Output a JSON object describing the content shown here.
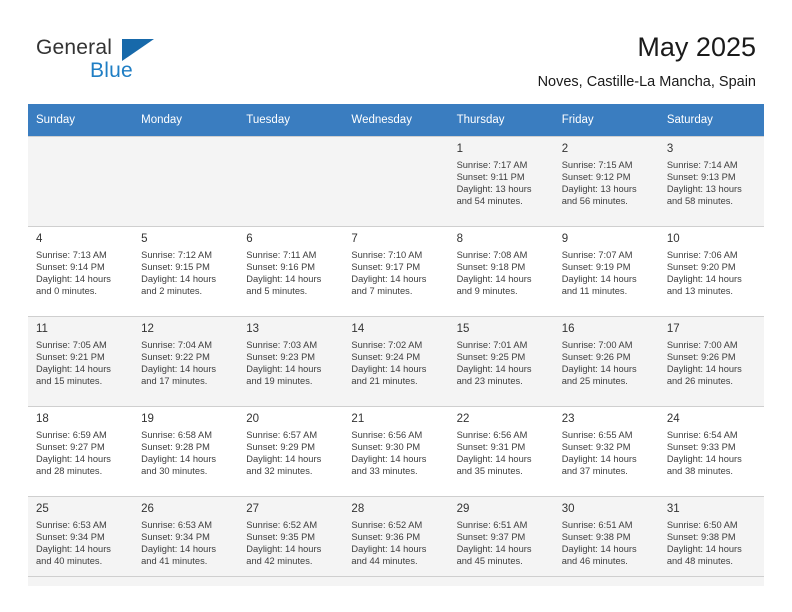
{
  "brand": {
    "name_part1": "General",
    "name_part2": "Blue",
    "flag_icon": "triangle-flag-icon",
    "accent_color": "#1f7ec4"
  },
  "header": {
    "title": "May 2025",
    "subtitle": "Noves, Castille-La Mancha, Spain"
  },
  "calendar": {
    "header_background": "#3a7dc0",
    "weekdays": [
      "Sunday",
      "Monday",
      "Tuesday",
      "Wednesday",
      "Thursday",
      "Friday",
      "Saturday"
    ],
    "weeks": [
      [
        {
          "day": "",
          "sunrise": "",
          "sunset": "",
          "daylight_line1": "",
          "daylight_line2": ""
        },
        {
          "day": "",
          "sunrise": "",
          "sunset": "",
          "daylight_line1": "",
          "daylight_line2": ""
        },
        {
          "day": "",
          "sunrise": "",
          "sunset": "",
          "daylight_line1": "",
          "daylight_line2": ""
        },
        {
          "day": "",
          "sunrise": "",
          "sunset": "",
          "daylight_line1": "",
          "daylight_line2": ""
        },
        {
          "day": "1",
          "sunrise": "Sunrise: 7:17 AM",
          "sunset": "Sunset: 9:11 PM",
          "daylight_line1": "Daylight: 13 hours",
          "daylight_line2": "and 54 minutes."
        },
        {
          "day": "2",
          "sunrise": "Sunrise: 7:15 AM",
          "sunset": "Sunset: 9:12 PM",
          "daylight_line1": "Daylight: 13 hours",
          "daylight_line2": "and 56 minutes."
        },
        {
          "day": "3",
          "sunrise": "Sunrise: 7:14 AM",
          "sunset": "Sunset: 9:13 PM",
          "daylight_line1": "Daylight: 13 hours",
          "daylight_line2": "and 58 minutes."
        }
      ],
      [
        {
          "day": "4",
          "sunrise": "Sunrise: 7:13 AM",
          "sunset": "Sunset: 9:14 PM",
          "daylight_line1": "Daylight: 14 hours",
          "daylight_line2": "and 0 minutes."
        },
        {
          "day": "5",
          "sunrise": "Sunrise: 7:12 AM",
          "sunset": "Sunset: 9:15 PM",
          "daylight_line1": "Daylight: 14 hours",
          "daylight_line2": "and 2 minutes."
        },
        {
          "day": "6",
          "sunrise": "Sunrise: 7:11 AM",
          "sunset": "Sunset: 9:16 PM",
          "daylight_line1": "Daylight: 14 hours",
          "daylight_line2": "and 5 minutes."
        },
        {
          "day": "7",
          "sunrise": "Sunrise: 7:10 AM",
          "sunset": "Sunset: 9:17 PM",
          "daylight_line1": "Daylight: 14 hours",
          "daylight_line2": "and 7 minutes."
        },
        {
          "day": "8",
          "sunrise": "Sunrise: 7:08 AM",
          "sunset": "Sunset: 9:18 PM",
          "daylight_line1": "Daylight: 14 hours",
          "daylight_line2": "and 9 minutes."
        },
        {
          "day": "9",
          "sunrise": "Sunrise: 7:07 AM",
          "sunset": "Sunset: 9:19 PM",
          "daylight_line1": "Daylight: 14 hours",
          "daylight_line2": "and 11 minutes."
        },
        {
          "day": "10",
          "sunrise": "Sunrise: 7:06 AM",
          "sunset": "Sunset: 9:20 PM",
          "daylight_line1": "Daylight: 14 hours",
          "daylight_line2": "and 13 minutes."
        }
      ],
      [
        {
          "day": "11",
          "sunrise": "Sunrise: 7:05 AM",
          "sunset": "Sunset: 9:21 PM",
          "daylight_line1": "Daylight: 14 hours",
          "daylight_line2": "and 15 minutes."
        },
        {
          "day": "12",
          "sunrise": "Sunrise: 7:04 AM",
          "sunset": "Sunset: 9:22 PM",
          "daylight_line1": "Daylight: 14 hours",
          "daylight_line2": "and 17 minutes."
        },
        {
          "day": "13",
          "sunrise": "Sunrise: 7:03 AM",
          "sunset": "Sunset: 9:23 PM",
          "daylight_line1": "Daylight: 14 hours",
          "daylight_line2": "and 19 minutes."
        },
        {
          "day": "14",
          "sunrise": "Sunrise: 7:02 AM",
          "sunset": "Sunset: 9:24 PM",
          "daylight_line1": "Daylight: 14 hours",
          "daylight_line2": "and 21 minutes."
        },
        {
          "day": "15",
          "sunrise": "Sunrise: 7:01 AM",
          "sunset": "Sunset: 9:25 PM",
          "daylight_line1": "Daylight: 14 hours",
          "daylight_line2": "and 23 minutes."
        },
        {
          "day": "16",
          "sunrise": "Sunrise: 7:00 AM",
          "sunset": "Sunset: 9:26 PM",
          "daylight_line1": "Daylight: 14 hours",
          "daylight_line2": "and 25 minutes."
        },
        {
          "day": "17",
          "sunrise": "Sunrise: 7:00 AM",
          "sunset": "Sunset: 9:26 PM",
          "daylight_line1": "Daylight: 14 hours",
          "daylight_line2": "and 26 minutes."
        }
      ],
      [
        {
          "day": "18",
          "sunrise": "Sunrise: 6:59 AM",
          "sunset": "Sunset: 9:27 PM",
          "daylight_line1": "Daylight: 14 hours",
          "daylight_line2": "and 28 minutes."
        },
        {
          "day": "19",
          "sunrise": "Sunrise: 6:58 AM",
          "sunset": "Sunset: 9:28 PM",
          "daylight_line1": "Daylight: 14 hours",
          "daylight_line2": "and 30 minutes."
        },
        {
          "day": "20",
          "sunrise": "Sunrise: 6:57 AM",
          "sunset": "Sunset: 9:29 PM",
          "daylight_line1": "Daylight: 14 hours",
          "daylight_line2": "and 32 minutes."
        },
        {
          "day": "21",
          "sunrise": "Sunrise: 6:56 AM",
          "sunset": "Sunset: 9:30 PM",
          "daylight_line1": "Daylight: 14 hours",
          "daylight_line2": "and 33 minutes."
        },
        {
          "day": "22",
          "sunrise": "Sunrise: 6:56 AM",
          "sunset": "Sunset: 9:31 PM",
          "daylight_line1": "Daylight: 14 hours",
          "daylight_line2": "and 35 minutes."
        },
        {
          "day": "23",
          "sunrise": "Sunrise: 6:55 AM",
          "sunset": "Sunset: 9:32 PM",
          "daylight_line1": "Daylight: 14 hours",
          "daylight_line2": "and 37 minutes."
        },
        {
          "day": "24",
          "sunrise": "Sunrise: 6:54 AM",
          "sunset": "Sunset: 9:33 PM",
          "daylight_line1": "Daylight: 14 hours",
          "daylight_line2": "and 38 minutes."
        }
      ],
      [
        {
          "day": "25",
          "sunrise": "Sunrise: 6:53 AM",
          "sunset": "Sunset: 9:34 PM",
          "daylight_line1": "Daylight: 14 hours",
          "daylight_line2": "and 40 minutes."
        },
        {
          "day": "26",
          "sunrise": "Sunrise: 6:53 AM",
          "sunset": "Sunset: 9:34 PM",
          "daylight_line1": "Daylight: 14 hours",
          "daylight_line2": "and 41 minutes."
        },
        {
          "day": "27",
          "sunrise": "Sunrise: 6:52 AM",
          "sunset": "Sunset: 9:35 PM",
          "daylight_line1": "Daylight: 14 hours",
          "daylight_line2": "and 42 minutes."
        },
        {
          "day": "28",
          "sunrise": "Sunrise: 6:52 AM",
          "sunset": "Sunset: 9:36 PM",
          "daylight_line1": "Daylight: 14 hours",
          "daylight_line2": "and 44 minutes."
        },
        {
          "day": "29",
          "sunrise": "Sunrise: 6:51 AM",
          "sunset": "Sunset: 9:37 PM",
          "daylight_line1": "Daylight: 14 hours",
          "daylight_line2": "and 45 minutes."
        },
        {
          "day": "30",
          "sunrise": "Sunrise: 6:51 AM",
          "sunset": "Sunset: 9:38 PM",
          "daylight_line1": "Daylight: 14 hours",
          "daylight_line2": "and 46 minutes."
        },
        {
          "day": "31",
          "sunrise": "Sunrise: 6:50 AM",
          "sunset": "Sunset: 9:38 PM",
          "daylight_line1": "Daylight: 14 hours",
          "daylight_line2": "and 48 minutes."
        }
      ]
    ]
  }
}
